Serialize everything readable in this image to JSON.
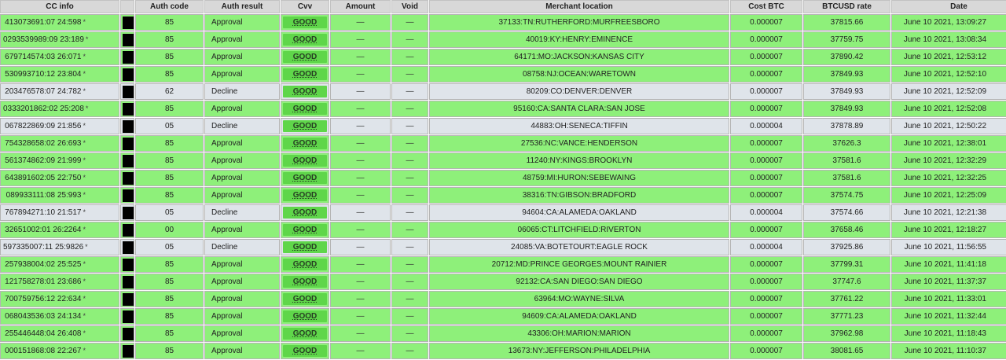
{
  "headers": {
    "cc_info": "CC info",
    "blank": "",
    "auth_code": "Auth code",
    "auth_result": "Auth result",
    "cvv": "Cvv",
    "amount": "Amount",
    "void": "Void",
    "merchant_location": "Merchant location",
    "cost_btc": "Cost BTC",
    "btcusd_rate": "BTCUSD rate",
    "date": "Date"
  },
  "colors": {
    "approval_row": "#8ef07a",
    "decline_row": "#dfe4ea",
    "cvv_badge": "#5fd64a",
    "header": "#d8d8d8"
  },
  "rows": [
    {
      "cc": "413073691:07 24:598",
      "star": "*",
      "auth": "85",
      "result": "Approval",
      "cvv": "GOOD",
      "amount": "—",
      "void": "—",
      "location": "37133:TN:RUTHERFORD:MURFREESBORO",
      "cost": "0.000007",
      "rate": "37815.66",
      "date": "June 10 2021, 13:09:27"
    },
    {
      "cc": "0293539989:09 23:189",
      "star": "*",
      "auth": "85",
      "result": "Approval",
      "cvv": "GOOD",
      "amount": "—",
      "void": "—",
      "location": "40019:KY:HENRY:EMINENCE",
      "cost": "0.000007",
      "rate": "37759.75",
      "date": "June 10 2021, 13:08:34"
    },
    {
      "cc": "679714574:03 26:071",
      "star": "*",
      "auth": "85",
      "result": "Approval",
      "cvv": "GOOD",
      "amount": "—",
      "void": "—",
      "location": "64171:MO:JACKSON:KANSAS CITY",
      "cost": "0.000007",
      "rate": "37890.42",
      "date": "June 10 2021, 12:53:12"
    },
    {
      "cc": "530993710:12 23:804",
      "star": "*",
      "auth": "85",
      "result": "Approval",
      "cvv": "GOOD",
      "amount": "—",
      "void": "—",
      "location": "08758:NJ:OCEAN:WARETOWN",
      "cost": "0.000007",
      "rate": "37849.93",
      "date": "June 10 2021, 12:52:10"
    },
    {
      "cc": "203476578:07 24:782",
      "star": "*",
      "auth": "62",
      "result": "Decline",
      "cvv": "GOOD",
      "amount": "—",
      "void": "—",
      "location": "80209:CO:DENVER:DENVER",
      "cost": "0.000007",
      "rate": "37849.93",
      "date": "June 10 2021, 12:52:09"
    },
    {
      "cc": "0333201862:02 25:208",
      "star": "*",
      "auth": "85",
      "result": "Approval",
      "cvv": "GOOD",
      "amount": "—",
      "void": "—",
      "location": "95160:CA:SANTA CLARA:SAN JOSE",
      "cost": "0.000007",
      "rate": "37849.93",
      "date": "June 10 2021, 12:52:08"
    },
    {
      "cc": "067822869:09 21:856",
      "star": "*",
      "auth": "05",
      "result": "Decline",
      "cvv": "GOOD",
      "amount": "—",
      "void": "—",
      "location": "44883:OH:SENECA:TIFFIN",
      "cost": "0.000004",
      "rate": "37878.89",
      "date": "June 10 2021, 12:50:22"
    },
    {
      "cc": "754328658:02 26:693",
      "star": "*",
      "auth": "85",
      "result": "Approval",
      "cvv": "GOOD",
      "amount": "—",
      "void": "—",
      "location": "27536:NC:VANCE:HENDERSON",
      "cost": "0.000007",
      "rate": "37626.3",
      "date": "June 10 2021, 12:38:01"
    },
    {
      "cc": "561374862:09 21:999",
      "star": "*",
      "auth": "85",
      "result": "Approval",
      "cvv": "GOOD",
      "amount": "—",
      "void": "—",
      "location": "11240:NY:KINGS:BROOKLYN",
      "cost": "0.000007",
      "rate": "37581.6",
      "date": "June 10 2021, 12:32:29"
    },
    {
      "cc": "643891602:05 22:750",
      "star": "*",
      "auth": "85",
      "result": "Approval",
      "cvv": "GOOD",
      "amount": "—",
      "void": "—",
      "location": "48759:MI:HURON:SEBEWAING",
      "cost": "0.000007",
      "rate": "37581.6",
      "date": "June 10 2021, 12:32:25"
    },
    {
      "cc": "089933111:08 25:993",
      "star": "*",
      "auth": "85",
      "result": "Approval",
      "cvv": "GOOD",
      "amount": "—",
      "void": "—",
      "location": "38316:TN:GIBSON:BRADFORD",
      "cost": "0.000007",
      "rate": "37574.75",
      "date": "June 10 2021, 12:25:09"
    },
    {
      "cc": "767894271:10 21:517",
      "star": "*",
      "auth": "05",
      "result": "Decline",
      "cvv": "GOOD",
      "amount": "—",
      "void": "—",
      "location": "94604:CA:ALAMEDA:OAKLAND",
      "cost": "0.000004",
      "rate": "37574.66",
      "date": "June 10 2021, 12:21:38"
    },
    {
      "cc": "32651002:01 26:2264",
      "star": "*",
      "auth": "00",
      "result": "Approval",
      "cvv": "GOOD",
      "amount": "—",
      "void": "—",
      "location": "06065:CT:LITCHFIELD:RIVERTON",
      "cost": "0.000007",
      "rate": "37658.46",
      "date": "June 10 2021, 12:18:27"
    },
    {
      "cc": "597335007:11 25:9826",
      "star": "*",
      "auth": "05",
      "result": "Decline",
      "cvv": "GOOD",
      "amount": "—",
      "void": "—",
      "location": "24085:VA:BOTETOURT:EAGLE ROCK",
      "cost": "0.000004",
      "rate": "37925.86",
      "date": "June 10 2021, 11:56:55"
    },
    {
      "cc": "257938004:02 25:525",
      "star": "*",
      "auth": "85",
      "result": "Approval",
      "cvv": "GOOD",
      "amount": "—",
      "void": "—",
      "location": "20712:MD:PRINCE GEORGES:MOUNT RAINIER",
      "cost": "0.000007",
      "rate": "37799.31",
      "date": "June 10 2021, 11:41:18"
    },
    {
      "cc": "121758278:01 23:686",
      "star": "*",
      "auth": "85",
      "result": "Approval",
      "cvv": "GOOD",
      "amount": "—",
      "void": "—",
      "location": "92132:CA:SAN DIEGO:SAN DIEGO",
      "cost": "0.000007",
      "rate": "37747.6",
      "date": "June 10 2021, 11:37:37"
    },
    {
      "cc": "700759756:12 22:634",
      "star": "*",
      "auth": "85",
      "result": "Approval",
      "cvv": "GOOD",
      "amount": "—",
      "void": "—",
      "location": "63964:MO:WAYNE:SILVA",
      "cost": "0.000007",
      "rate": "37761.22",
      "date": "June 10 2021, 11:33:01"
    },
    {
      "cc": "068043536:03 24:134",
      "star": "*",
      "auth": "85",
      "result": "Approval",
      "cvv": "GOOD",
      "amount": "—",
      "void": "—",
      "location": "94609:CA:ALAMEDA:OAKLAND",
      "cost": "0.000007",
      "rate": "37771.23",
      "date": "June 10 2021, 11:32:44"
    },
    {
      "cc": "255446448:04 26:408",
      "star": "*",
      "auth": "85",
      "result": "Approval",
      "cvv": "GOOD",
      "amount": "—",
      "void": "—",
      "location": "43306:OH:MARION:MARION",
      "cost": "0.000007",
      "rate": "37962.98",
      "date": "June 10 2021, 11:18:43"
    },
    {
      "cc": "000151868:08 22:267",
      "star": "*",
      "auth": "85",
      "result": "Approval",
      "cvv": "GOOD",
      "amount": "—",
      "void": "—",
      "location": "13673:NY:JEFFERSON:PHILADELPHIA",
      "cost": "0.000007",
      "rate": "38081.65",
      "date": "June 10 2021, 11:10:37"
    }
  ]
}
